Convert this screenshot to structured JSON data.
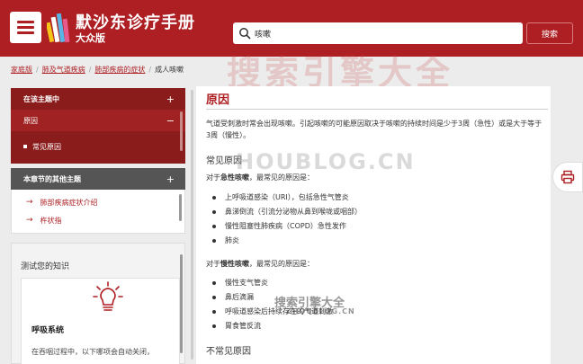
{
  "header": {
    "title": "默沙东诊疗手册",
    "subtitle": "大众版",
    "brand_color": "#ad1f23",
    "menu_icon": "hamburger-menu-icon",
    "logo_icon": "book-spines-logo"
  },
  "search": {
    "value": "咳嗽",
    "button_label": "搜索",
    "icon": "search-icon"
  },
  "breadcrumb": {
    "items": [
      "家庭版",
      "肺及气道疾病",
      "肺部疾病的症状"
    ],
    "current": "成人咳嗽"
  },
  "sidebar": {
    "related": {
      "heading": "在该主题中",
      "heading_toggle": "+",
      "items": [
        {
          "label": "原因",
          "toggle": "−"
        }
      ],
      "sub_items": [
        "常见原因"
      ]
    },
    "other": {
      "heading": "本章节的其他主题",
      "heading_toggle": "+",
      "links": [
        "肺部疾病症状介绍",
        "杵状指"
      ]
    },
    "quiz": {
      "title": "测试您的知识",
      "card_title": "呼吸系统",
      "card_text": "在吞咽过程中，以下哪项会自动关闭，",
      "icon": "lightbulb-icon"
    }
  },
  "main": {
    "heading": "原因",
    "intro": "气道受刺激时常会出现咳嗽。引起咳嗽的可能原因取决于咳嗽的持续时间是少于3周（急性）或是大于等于3周（慢性）。",
    "section1_heading": "常见原因",
    "acute_prefix": "对于",
    "acute_bold": "急性咳嗽",
    "acute_suffix": "，最常见的原因是：",
    "acute_list": [
      "上呼吸道感染（URI），包括急性气管炎",
      "鼻涕倒流（引流分泌物从鼻到喉咙或咽部）",
      "慢性阻塞性肺疾病（COPD）急性发作",
      "肺炎"
    ],
    "chronic_prefix": "对于",
    "chronic_bold": "慢性咳嗽",
    "chronic_suffix": "，最常见的原因是：",
    "chronic_list": [
      "慢性支气管炎",
      "鼻后滴漏",
      "呼吸道感染后持续存在的气道刺激",
      "胃食管反流"
    ],
    "section2_heading": "不常见原因"
  },
  "print": {
    "icon": "printer-icon"
  },
  "watermarks": {
    "big": "搜索引擎大全",
    "domain": "HOUBLOG.CN",
    "small": "搜索引擎大全",
    "small_domain": "ZHOUBLOG.CN"
  }
}
